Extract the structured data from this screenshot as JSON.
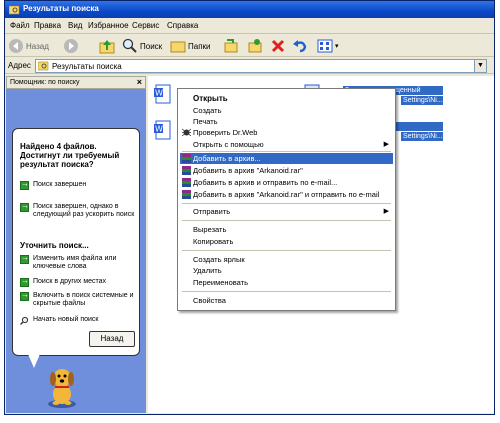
{
  "window": {
    "title": "Результаты поиска"
  },
  "menubar": {
    "items": [
      "Файл",
      "Правка",
      "Вид",
      "Избранное",
      "Сервис",
      "Справка"
    ]
  },
  "toolbar": {
    "back_label": "Назад",
    "search_label": "Поиск",
    "folders_label": "Папки"
  },
  "address": {
    "label": "Адрес",
    "value": "Результаты поиска"
  },
  "left_pane": {
    "header": "Помощник: по поиску",
    "close": "×",
    "question": "Найдено 4 файлов. Достигнут ли требуемый результат поиска?",
    "items_done": [
      "Поиск завершен",
      "Поиск завершен, однако в следующий раз ускорить поиск"
    ],
    "refine_heading": "Уточнить поиск...",
    "items_refine": [
      "Изменить имя файла или ключевые слова",
      "Поиск в других местах",
      "Включить в поиск системные и скрытые файлы"
    ],
    "new_search": "Начать новый поиск",
    "back_button": "Назад"
  },
  "files": [
    {
      "name_line1": "Занятие, посвященный",
      "name_line2": "Settings\\Ni..."
    },
    {
      "name_line1": "",
      "name_line2": "Settings\\Ni..."
    }
  ],
  "context_menu": {
    "items": [
      {
        "label": "Открыть",
        "bold": true
      },
      {
        "label": "Создать"
      },
      {
        "label": "Печать"
      },
      {
        "label": "Проверить Dr.Web",
        "icon": "drweb-icon"
      },
      {
        "label": "Открыть с помощью",
        "submenu": "▶"
      },
      {
        "label": "Добавить в архив...",
        "icon": "winrar-icon",
        "selected": true
      },
      {
        "label": "Добавить в архив \"Arkanoid.rar\"",
        "icon": "winrar-icon"
      },
      {
        "label": "Добавить в архив и отправить по e-mail...",
        "icon": "winrar-icon"
      },
      {
        "label": "Добавить в архив \"Arkanoid.rar\" и отправить по e-mail",
        "icon": "winrar-icon"
      },
      {
        "label": "Отправить",
        "submenu": "▶"
      },
      {
        "label": "Вырезать"
      },
      {
        "label": "Копировать"
      },
      {
        "label": "Создать ярлык"
      },
      {
        "label": "Удалить"
      },
      {
        "label": "Переименовать"
      },
      {
        "label": "Свойства"
      }
    ]
  },
  "colors": {
    "titlebar": "#0b49c8",
    "selection": "#316ac5",
    "left_pane_bg": "#6f8fdc"
  }
}
